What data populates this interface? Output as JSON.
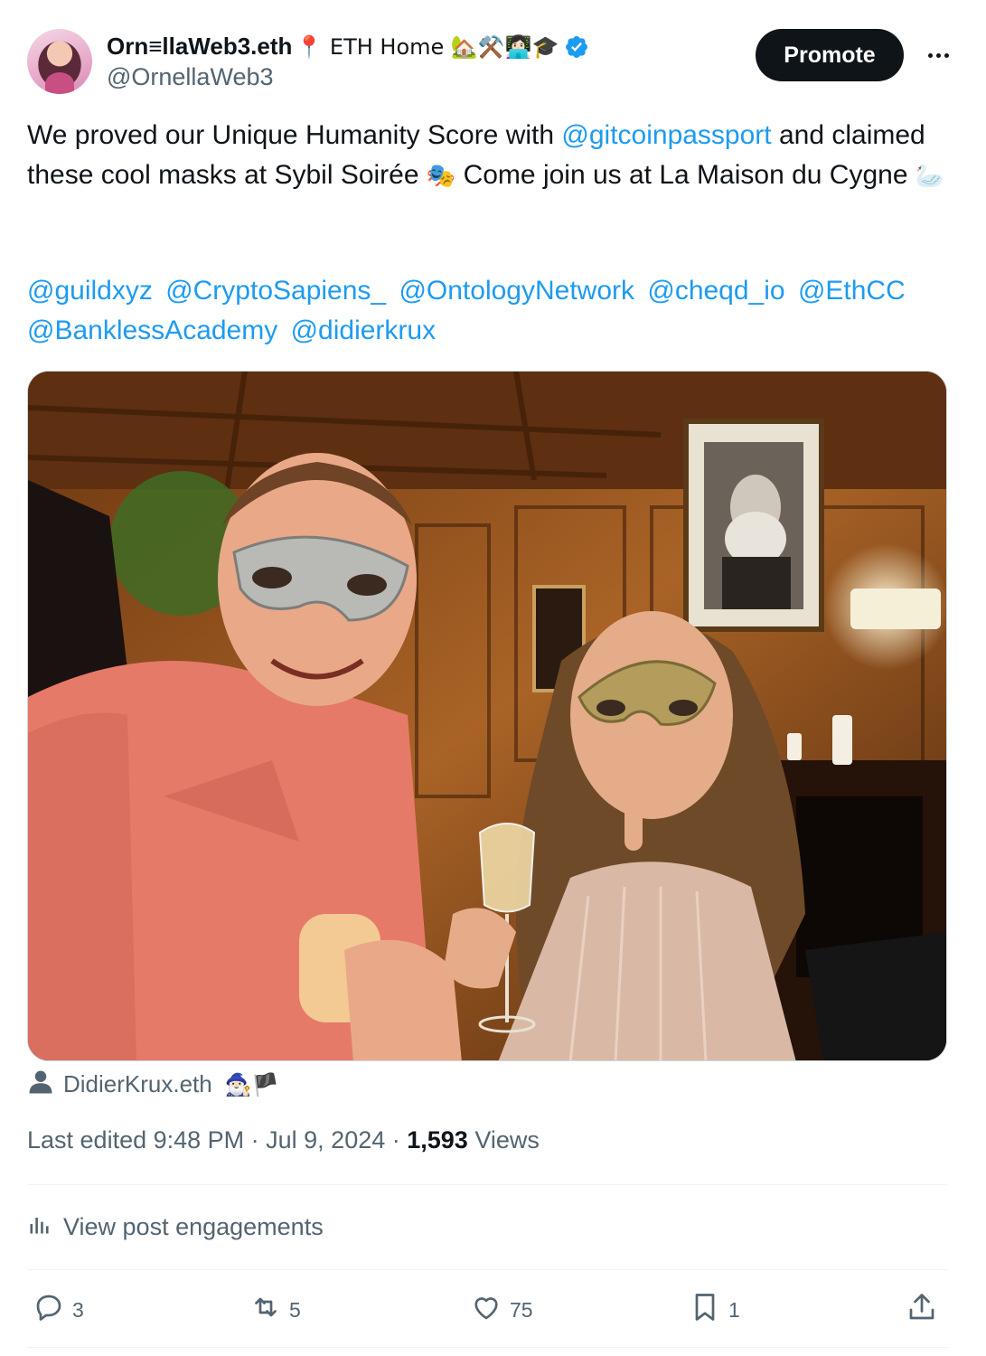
{
  "author": {
    "display_name": "Orn≡llaWeb3.eth",
    "name_emojis": "📍 ETH Home 🏡⚒️👩🏻‍💻🎓",
    "handle": "@OrnellaWeb3",
    "verified": true
  },
  "header": {
    "promote_label": "Promote",
    "more_icon": "more-horizontal-icon"
  },
  "post": {
    "line1_prefix": "We proved our Unique Humanity Score with ",
    "mention_gitcoin": "@gitcoinpassport",
    "line1_suffix": " and claimed these cool masks at Sybil Soirée ",
    "masks_emoji": "🎭",
    "line2": "  Come join us at La Maison du Cygne ",
    "swan_emoji": "🦢",
    "mentions": [
      "@guildxyz",
      "@CryptoSapiens_",
      "@OntologyNetwork",
      "@cheqd_io",
      "@EthCC",
      "@BanklessAcademy",
      "@didierkrux"
    ]
  },
  "tagged": {
    "name": "DidierKrux.eth",
    "emojis": "🧙🏻‍♂️🏴"
  },
  "meta": {
    "edited_time": "Last edited 9:48 PM · Jul 9, 2024 · ",
    "views_count": "1,593",
    "views_label": " Views"
  },
  "engagements_label": "View post engagements",
  "actions": {
    "replies": "3",
    "reposts": "5",
    "likes": "75",
    "bookmarks": "1"
  },
  "colors": {
    "accent": "#1d9bf0",
    "text": "#0f1419",
    "muted": "#536471",
    "promote_bg": "#0f1419"
  }
}
